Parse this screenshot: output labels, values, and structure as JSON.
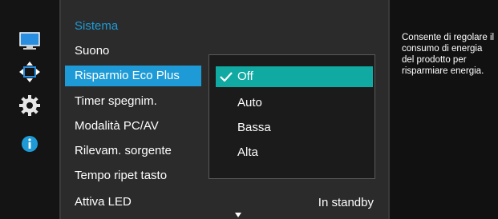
{
  "sidebar": {
    "icons": [
      "monitor-icon",
      "move-arrows-icon",
      "gear-icon",
      "info-icon"
    ]
  },
  "menu": {
    "title": "Sistema",
    "items": [
      {
        "label": "Suono"
      },
      {
        "label": "Risparmio Eco Plus"
      },
      {
        "label": "Timer spegnim."
      },
      {
        "label": "Modalità PC/AV"
      },
      {
        "label": "Rilevam. sorgente"
      },
      {
        "label": "Tempo ripet tasto"
      },
      {
        "label": "Attiva LED",
        "value": "In standby"
      }
    ],
    "selected_index": 1
  },
  "submenu": {
    "options": [
      "Off",
      "Auto",
      "Bassa",
      "Alta"
    ],
    "selected": "Off"
  },
  "help": {
    "text": "Consente di regolare il consumo di energia del prodotto per risparmiare energia."
  },
  "colors": {
    "selection_blue": "#1e9bd7",
    "selection_teal": "#10aaa3",
    "menu_bg": "#2b2b2b"
  }
}
